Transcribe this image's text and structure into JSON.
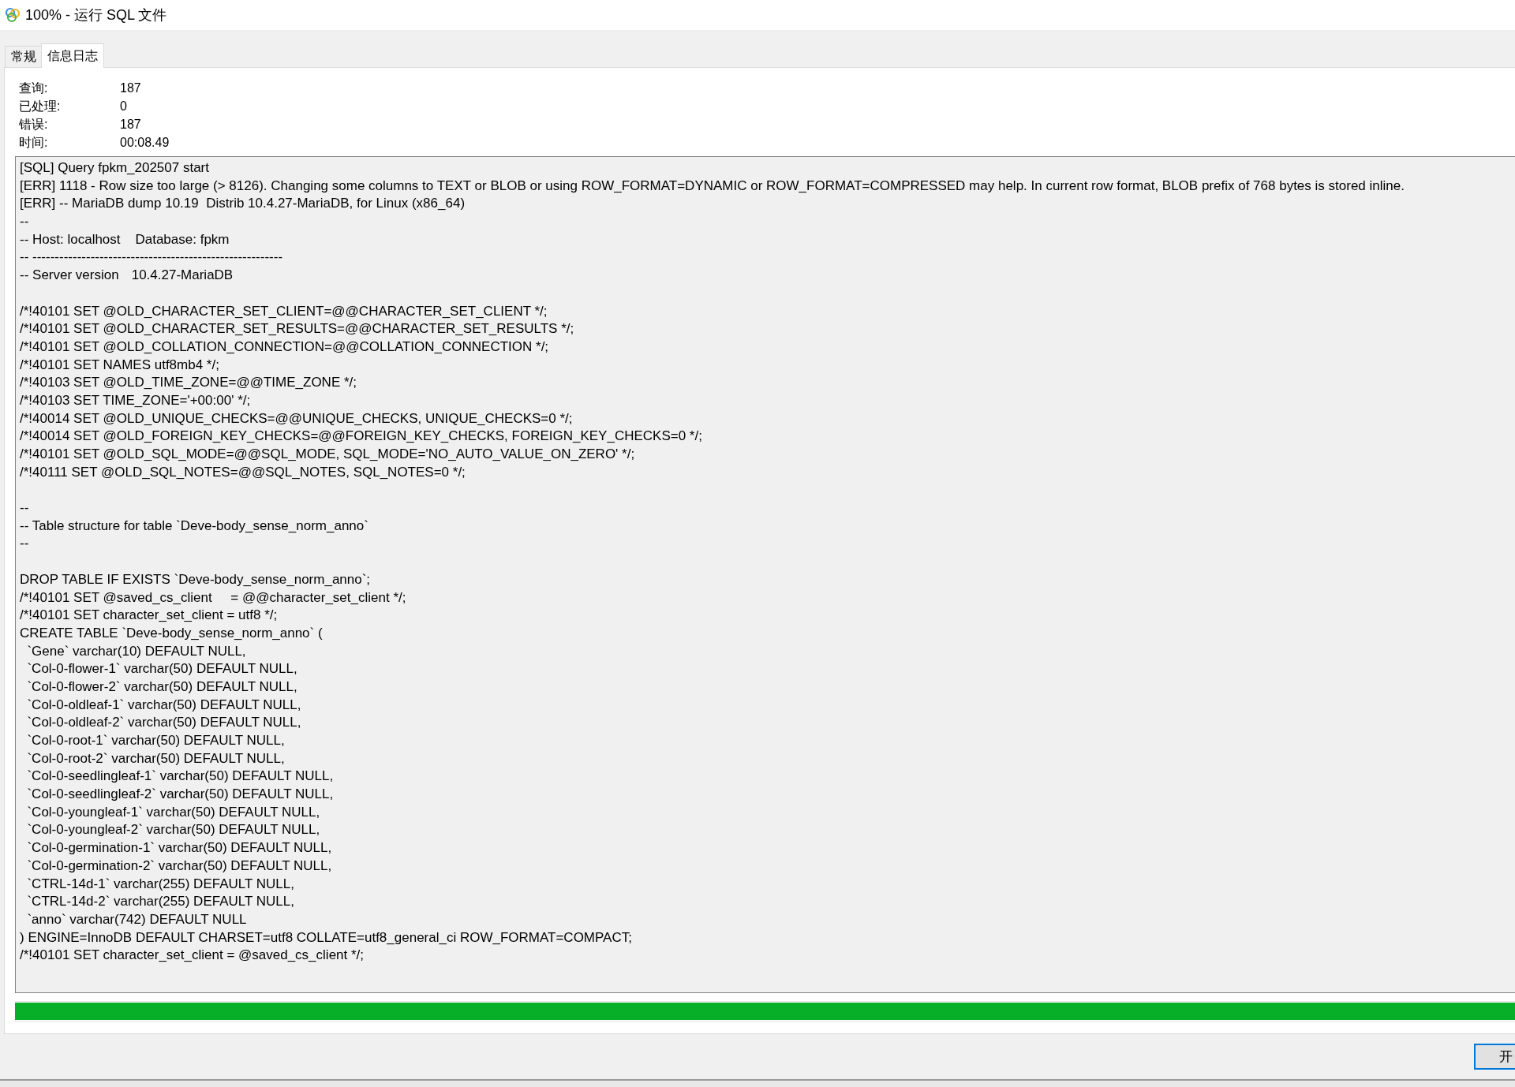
{
  "window": {
    "title": "100% - 运行 SQL 文件"
  },
  "tabs": [
    {
      "label": "常规",
      "selected": false
    },
    {
      "label": "信息日志",
      "selected": true
    }
  ],
  "stats": [
    {
      "label": "查询:",
      "value": "187"
    },
    {
      "label": "已处理:",
      "value": "0"
    },
    {
      "label": "错误:",
      "value": "187"
    },
    {
      "label": "时间:",
      "value": "00:08.49"
    }
  ],
  "log": {
    "blocks": [
      [
        "[SQL] Query fpkm_202507 start",
        "[ERR] 1118 - Row size too large (> 8126). Changing some columns to TEXT or BLOB or using ROW_FORMAT=DYNAMIC or ROW_FORMAT=COMPRESSED may help. In current row format, BLOB prefix of 768 bytes is stored inline.",
        "[ERR] -- MariaDB dump 10.19  Distrib 10.4.27-MariaDB, for Linux (x86_64)",
        "--",
        "-- Host: localhost    Database: fpkm",
        "-- --------------------------------------------------------",
        "-- Server version\t10.4.27-MariaDB"
      ],
      [
        "/*!40101 SET @OLD_CHARACTER_SET_CLIENT=@@CHARACTER_SET_CLIENT */;",
        "/*!40101 SET @OLD_CHARACTER_SET_RESULTS=@@CHARACTER_SET_RESULTS */;",
        "/*!40101 SET @OLD_COLLATION_CONNECTION=@@COLLATION_CONNECTION */;",
        "/*!40101 SET NAMES utf8mb4 */;",
        "/*!40103 SET @OLD_TIME_ZONE=@@TIME_ZONE */;",
        "/*!40103 SET TIME_ZONE='+00:00' */;",
        "/*!40014 SET @OLD_UNIQUE_CHECKS=@@UNIQUE_CHECKS, UNIQUE_CHECKS=0 */;",
        "/*!40014 SET @OLD_FOREIGN_KEY_CHECKS=@@FOREIGN_KEY_CHECKS, FOREIGN_KEY_CHECKS=0 */;",
        "/*!40101 SET @OLD_SQL_MODE=@@SQL_MODE, SQL_MODE='NO_AUTO_VALUE_ON_ZERO' */;",
        "/*!40111 SET @OLD_SQL_NOTES=@@SQL_NOTES, SQL_NOTES=0 */;"
      ],
      [
        "--",
        "-- Table structure for table `Deve-body_sense_norm_anno`",
        "--"
      ],
      [
        "DROP TABLE IF EXISTS `Deve-body_sense_norm_anno`;",
        "/*!40101 SET @saved_cs_client     = @@character_set_client */;",
        "/*!40101 SET character_set_client = utf8 */;",
        "CREATE TABLE `Deve-body_sense_norm_anno` (",
        "  `Gene` varchar(10) DEFAULT NULL,",
        "  `Col-0-flower-1` varchar(50) DEFAULT NULL,",
        "  `Col-0-flower-2` varchar(50) DEFAULT NULL,",
        "  `Col-0-oldleaf-1` varchar(50) DEFAULT NULL,",
        "  `Col-0-oldleaf-2` varchar(50) DEFAULT NULL,",
        "  `Col-0-root-1` varchar(50) DEFAULT NULL,",
        "  `Col-0-root-2` varchar(50) DEFAULT NULL,",
        "  `Col-0-seedlingleaf-1` varchar(50) DEFAULT NULL,",
        "  `Col-0-seedlingleaf-2` varchar(50) DEFAULT NULL,",
        "  `Col-0-youngleaf-1` varchar(50) DEFAULT NULL,",
        "  `Col-0-youngleaf-2` varchar(50) DEFAULT NULL,",
        "  `Col-0-germination-1` varchar(50) DEFAULT NULL,",
        "  `Col-0-germination-2` varchar(50) DEFAULT NULL,",
        "  `CTRL-14d-1` varchar(255) DEFAULT NULL,",
        "  `CTRL-14d-2` varchar(255) DEFAULT NULL,",
        "  `anno` varchar(742) DEFAULT NULL",
        ") ENGINE=InnoDB DEFAULT CHARSET=utf8 COLLATE=utf8_general_ci ROW_FORMAT=COMPACT;",
        "/*!40101 SET character_set_client = @saved_cs_client */;"
      ]
    ]
  },
  "progress": {
    "level": 1
  },
  "buttons": [
    "开"
  ]
}
